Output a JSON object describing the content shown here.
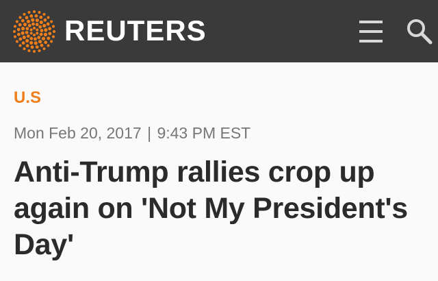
{
  "header": {
    "logo_text": "REUTERS",
    "logo_icon": "reuters-sphere-logo",
    "menu_icon": "hamburger-menu-icon",
    "search_icon": "search-icon",
    "background_color": "#3a3a3a",
    "logo_color": "#f07e1a"
  },
  "article": {
    "section": "U.S",
    "date": "Mon Feb 20, 2017",
    "separator": "|",
    "time": "9:43 PM EST",
    "headline": "Anti-Trump rallies crop up again on 'Not My President's Day'",
    "section_color": "#f07e1a"
  }
}
